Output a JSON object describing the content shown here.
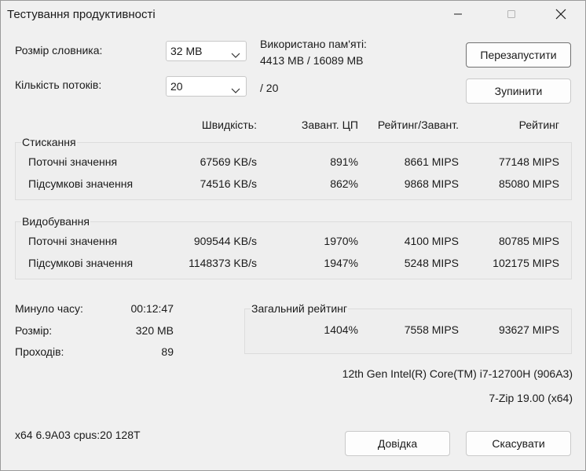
{
  "window": {
    "title": "Тестування продуктивності",
    "minimize_icon": "minimize-icon",
    "maximize_icon": "maximize-icon",
    "close_icon": "close-icon"
  },
  "settings": {
    "dict_label": "Розмір словника:",
    "dict_value": "32 MB",
    "threads_label": "Кількість потоків:",
    "threads_value": "20",
    "threads_total": "/ 20",
    "memory_label": "Використано пам'яті:",
    "memory_value": "4413 MB / 16089 MB"
  },
  "buttons": {
    "restart": "Перезапустити",
    "stop": "Зупинити",
    "help": "Довідка",
    "cancel": "Скасувати"
  },
  "columns": {
    "speed": "Швидкість:",
    "cpu": "Завант. ЦП",
    "rating_per_usage": "Рейтинг/Завант.",
    "rating": "Рейтинг"
  },
  "compression": {
    "label": "Стискання",
    "rows": [
      {
        "name": "Поточні значення",
        "speed": "67569 KB/s",
        "cpu": "891%",
        "rpu": "8661 MIPS",
        "rating": "77148 MIPS"
      },
      {
        "name": "Підсумкові значення",
        "speed": "74516 KB/s",
        "cpu": "862%",
        "rpu": "9868 MIPS",
        "rating": "85080 MIPS"
      }
    ]
  },
  "decompression": {
    "label": "Видобування",
    "rows": [
      {
        "name": "Поточні значення",
        "speed": "909544 KB/s",
        "cpu": "1970%",
        "rpu": "4100 MIPS",
        "rating": "80785 MIPS"
      },
      {
        "name": "Підсумкові значення",
        "speed": "1148373 KB/s",
        "cpu": "1947%",
        "rpu": "5248 MIPS",
        "rating": "102175 MIPS"
      }
    ]
  },
  "stats": {
    "elapsed_label": "Минуло часу:",
    "elapsed_value": "00:12:47",
    "size_label": "Розмір:",
    "size_value": "320 MB",
    "passes_label": "Проходів:",
    "passes_value": "89"
  },
  "total": {
    "label": "Загальний рейтинг",
    "cpu": "1404%",
    "rpu": "7558 MIPS",
    "rating": "93627 MIPS"
  },
  "system": {
    "cpu_name": "12th Gen Intel(R) Core(TM) i7-12700H (906A3)",
    "version": "7-Zip 19.00 (x64)",
    "build_info": "x64 6.9A03 cpus:20 128T"
  }
}
